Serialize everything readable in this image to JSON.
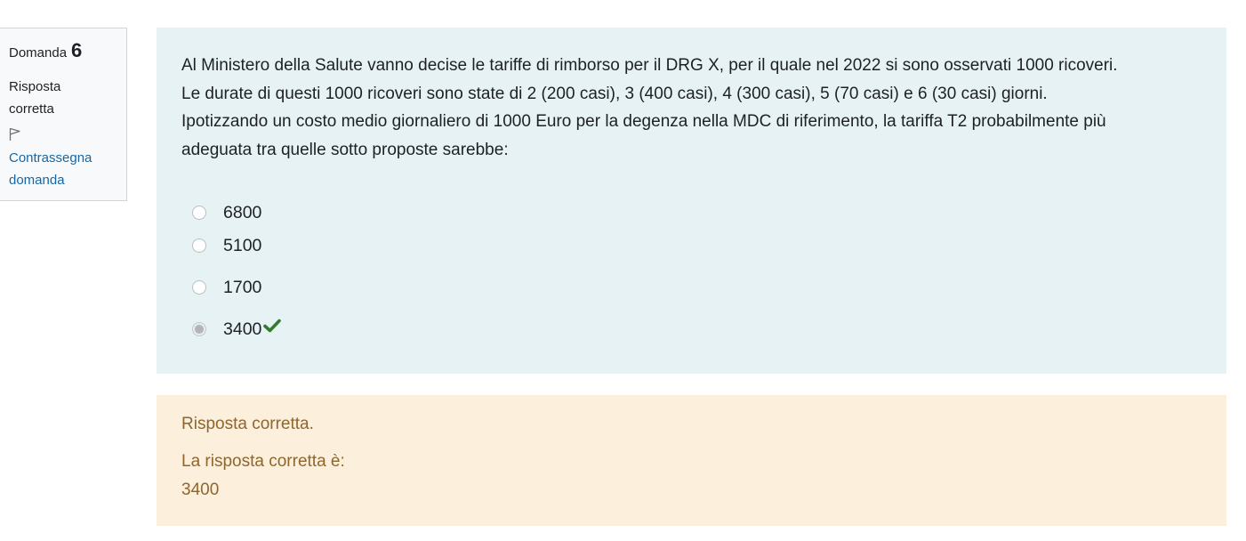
{
  "info": {
    "question_label": "Domanda",
    "question_number": "6",
    "state": "Risposta corretta",
    "flag_label": "Contrassegna domanda"
  },
  "question": {
    "lines": [
      "Al Ministero della Salute vanno decise le tariffe di rimborso per il DRG X, per il quale nel 2022 si sono osservati 1000 ricoveri.",
      "Le durate di questi 1000 ricoveri sono state di 2 (200 casi), 3 (400 casi), 4 (300 casi), 5 (70 casi) e 6 (30 casi) giorni.",
      "Ipotizzando un costo medio giornaliero di 1000 Euro per la degenza nella MDC di riferimento, la tariffa T2 probabilmente più",
      "adeguata tra quelle sotto proposte sarebbe:"
    ],
    "options": [
      {
        "label": "6800",
        "selected": false
      },
      {
        "label": "5100",
        "selected": false
      },
      {
        "label": "1700",
        "selected": false
      },
      {
        "label": "3400",
        "selected": true,
        "marked_correct": true
      }
    ]
  },
  "feedback": {
    "status": "Risposta corretta.",
    "right_answer_label": "La risposta corretta è:",
    "right_answer_value": "3400"
  },
  "colors": {
    "question_bg": "#e7f2f5",
    "feedback_bg": "#fcefdc",
    "feedback_text": "#8e662e",
    "link": "#1468a8",
    "check": "#357a32"
  }
}
